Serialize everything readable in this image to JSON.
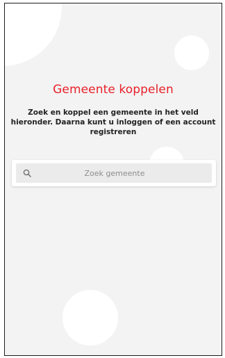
{
  "header": {
    "title": "Gemeente koppelen",
    "subtitle": "Zoek en koppel een gemeente in het veld hieronder. Daarna kunt u inloggen of een account registreren"
  },
  "search": {
    "placeholder": "Zoek gemeente",
    "value": "",
    "icon": "search-icon"
  },
  "colors": {
    "accent": "#e8212a",
    "background": "#f3f3f3",
    "text": "#222222"
  }
}
